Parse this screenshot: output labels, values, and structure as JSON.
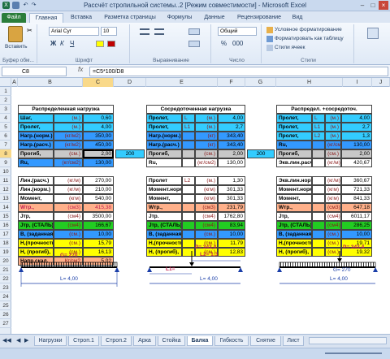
{
  "window": {
    "title": "Рассчёт стропильной системы..2  [Режим совместимости]  -  Microsoft Excel"
  },
  "ribbon_tabs": [
    "Файл",
    "Главная",
    "Вставка",
    "Разметка страницы",
    "Формулы",
    "Данные",
    "Рецензирование",
    "Вид"
  ],
  "ribbon": {
    "paste_label": "Вставить",
    "clipboard_group": "Буфер обм...",
    "font_name": "Arial Cyr",
    "font_size": "10",
    "font_group": "Шрифт",
    "align_group": "Выравнивание",
    "number_format": "Общий",
    "number_group": "Число",
    "cond_format": "Условное форматирование",
    "format_table": "Форматировать как таблицу",
    "cell_styles": "Стили ячеек",
    "styles_group": "Стили"
  },
  "formula_bar": {
    "name_box": "C8",
    "fx": "fx",
    "formula": "=C5*100/D8"
  },
  "columns": [
    "A",
    "B",
    "C",
    "D",
    "E",
    "F",
    "G",
    "H",
    "I",
    "J"
  ],
  "rows": [
    "1",
    "2",
    "3",
    "4",
    "5",
    "6",
    "7",
    "8",
    "9",
    "10",
    "11",
    "12",
    "13",
    "14",
    "15",
    "16",
    "17",
    "18",
    "19",
    "20",
    "21",
    "22",
    "23",
    "24",
    "25",
    "26",
    "27"
  ],
  "left_block": {
    "header": "Распределенная нагрузка",
    "rows": [
      {
        "label": "Шаг,",
        "unit": "(м.)",
        "value": "0,60"
      },
      {
        "label": "Пролет,",
        "unit": "(м.)",
        "value": "4,00"
      },
      {
        "label": "Нагр.(норм.)",
        "unit": "(кг/м2)",
        "value": "350,00"
      },
      {
        "label": "Нагр.(расч.)",
        "unit": "(кг/м2)",
        "value": "450,00"
      },
      {
        "label": "Прогиб,",
        "unit": "(см.)",
        "value": "2,00"
      },
      {
        "label": "Ru,",
        "unit": "(кг/см2)",
        "value": "130,00"
      },
      {
        "label": "",
        "unit": "",
        "value": ""
      },
      {
        "label": "Лин.(расч.)",
        "unit": "(кг/м)",
        "value": "270,00"
      },
      {
        "label": "Лин.(норм.)",
        "unit": "(кг/м)",
        "value": "210,00"
      },
      {
        "label": "Момент,",
        "unit": "(кгм)",
        "value": "540,00"
      },
      {
        "label": "Wтр.,",
        "unit": "(см3)",
        "value": "415,38"
      },
      {
        "label": "Jтр,",
        "unit": "(см4)",
        "value": "3500,00"
      },
      {
        "label": "Jтр, (СТАЛЬ)",
        "unit": "(см4)",
        "value": "166,67"
      },
      {
        "label": "В, (заданная),",
        "unit": "(см.)",
        "value": "10,00"
      },
      {
        "label": "Н,(прочность),",
        "unit": "(см.)",
        "value": "15,79"
      },
      {
        "label": "Н, (прогиб),",
        "unit": "(см.)",
        "value": "16,13"
      },
      {
        "label": "Напр.скал.",
        "unit": "Кг/см2",
        "value": "5,02"
      }
    ],
    "between_value": "200"
  },
  "mid_block": {
    "header": "Сосредоточенная нагрузка",
    "rows": [
      {
        "label": "Пролет,",
        "unit": "L",
        "unit2": "(м.)",
        "value": "4,00"
      },
      {
        "label": "Пролет,",
        "unit": "L1",
        "unit2": "(м.)",
        "value": "2,7"
      },
      {
        "label": "Нагр.(норм.)",
        "unit": "",
        "unit2": "(кг)",
        "value": "343,40"
      },
      {
        "label": "Нагр.(расч.)",
        "unit": "",
        "unit2": "(кг)",
        "value": "343,40"
      },
      {
        "label": "Прогиб,",
        "unit": "",
        "unit2": "(см.)",
        "value": "2,00"
      },
      {
        "label": "Ru,",
        "unit": "",
        "unit2": "(кг/см2)",
        "value": "130,00"
      },
      {
        "label": "",
        "unit": "",
        "unit2": "",
        "value": ""
      },
      {
        "label": "Пролет",
        "unit": "L2",
        "unit2": "(м.)",
        "value": "1,30"
      },
      {
        "label": "Момент.норм.",
        "unit": "",
        "unit2": "(кгм)",
        "value": "301,33"
      },
      {
        "label": "Момент,",
        "unit": "",
        "unit2": "(кгм)",
        "value": "301,33"
      },
      {
        "label": "Wтр.,",
        "unit": "",
        "unit2": "(см3)",
        "value": "231,79"
      },
      {
        "label": "Jтр.",
        "unit": "",
        "unit2": "(см4)",
        "value": "1762,80"
      },
      {
        "label": "Jтр, (СТАЛЬ)",
        "unit": "",
        "unit2": "(см4)",
        "value": "83,94"
      },
      {
        "label": "В, (заданная),",
        "unit": "",
        "unit2": "(см.)",
        "value": "10,00"
      },
      {
        "label": "Н,(прочность),",
        "unit": "",
        "unit2": "(см.)",
        "value": "11,79"
      },
      {
        "label": "Н, (прогиб),",
        "unit": "",
        "unit2": "(см.)",
        "value": "12,83"
      }
    ],
    "between_value": "200"
  },
  "right_block": {
    "header": "Распредел. +сосредоточ.",
    "rows": [
      {
        "label": "Пролет,",
        "unit": "L",
        "unit2": "(м.)",
        "value": "4,00"
      },
      {
        "label": "Пролет,",
        "unit": "L1",
        "unit2": "(м.)",
        "value": "2,7"
      },
      {
        "label": "Пролет,",
        "unit": "L2",
        "unit2": "(м.)",
        "value": "1,3"
      },
      {
        "label": "Ru,",
        "unit": "",
        "unit2": "(кг/см2)",
        "value": "130,00"
      },
      {
        "label": "Прогиб,",
        "unit": "",
        "unit2": "(см.)",
        "value": "2,00"
      },
      {
        "label": "Экв.лин.расч.",
        "unit": "",
        "unit2": "(кг/м)",
        "value": "420,67"
      },
      {
        "label": "",
        "unit": "",
        "unit2": "",
        "value": ""
      },
      {
        "label": "Экв.лин.норм.",
        "unit": "",
        "unit2": "(кг/м)",
        "value": "360,67"
      },
      {
        "label": "Момент.норм.",
        "unit": "",
        "unit2": "(кгм)",
        "value": "721,33"
      },
      {
        "label": "Момент,",
        "unit": "",
        "unit2": "(кгм)",
        "value": "841,33"
      },
      {
        "label": "Wтр.,",
        "unit": "",
        "unit2": "(см3)",
        "value": "647,18"
      },
      {
        "label": "Jтр,",
        "unit": "",
        "unit2": "(см4)",
        "value": "6011,17"
      },
      {
        "label": "Jтр, (СТАЛЬ)",
        "unit": "",
        "unit2": "(см4)",
        "value": "286,25"
      },
      {
        "label": "В, (заданная),",
        "unit": "",
        "unit2": "(см.)",
        "value": "10,00"
      },
      {
        "label": "Н,(прочность),",
        "unit": "",
        "unit2": "(см.)",
        "value": "19,71"
      },
      {
        "label": "Н, (прогиб),",
        "unit": "",
        "unit2": "(см.)",
        "value": "19,32"
      }
    ]
  },
  "diagrams": {
    "left": {
      "g_label": "G= 270",
      "l_label": "L= 4,00"
    },
    "mid": {
      "p_label": "P= 343,4",
      "l2_label": "L2= 1,3",
      "l1_label": "L1=",
      "l_label": "L= 4,00"
    },
    "right": {
      "p_label": "P= 343,4",
      "g_label": "G= 270",
      "l_label": "L= 4,00"
    }
  },
  "sheet_tabs": [
    "Нагрузки",
    "Строп.1",
    "Строп.2",
    "Арка",
    "Стойка",
    "Балка",
    "Гибкость",
    "Снятие",
    "Лист"
  ],
  "active_sheet": "Балка",
  "colors": {
    "cyan": "#33ccff",
    "blue": "#3399ff",
    "green": "#22cc22",
    "yellow": "#ffff00",
    "salmon": "#ffb08a",
    "grey": "#c8c8c8"
  }
}
